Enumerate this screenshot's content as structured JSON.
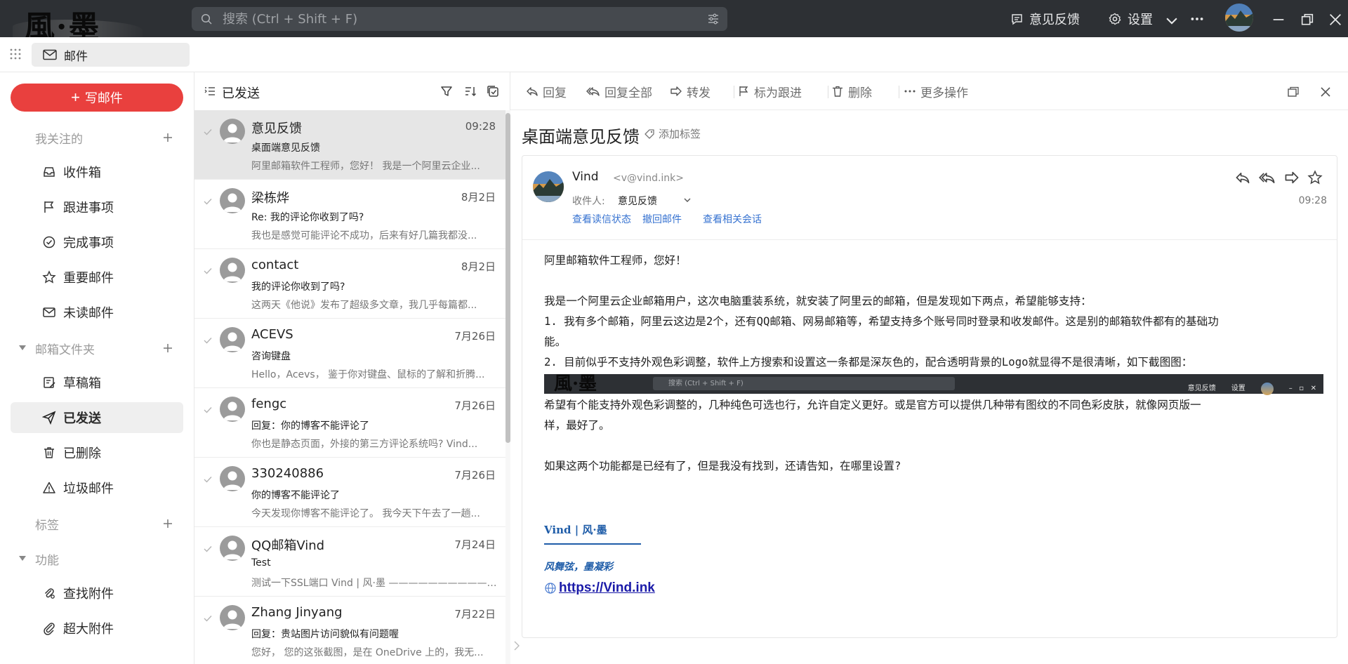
{
  "topbar": {
    "logo_text": "風·墨",
    "search_placeholder": "搜索 (Ctrl + Shift + F)",
    "feedback_label": "意见反馈",
    "settings_label": "设置",
    "icons": [
      "search-icon",
      "filter-icon",
      "feedback-icon",
      "gear-icon",
      "chevron-down-icon",
      "more-icon",
      "avatar",
      "minimize-icon",
      "restore-icon",
      "close-icon"
    ]
  },
  "tabbar": {
    "tab_label": "邮件"
  },
  "sidebar": {
    "compose_label": "写邮件",
    "sections": {
      "followed": "我关注的",
      "folders": "邮箱文件夹",
      "tags": "标签",
      "functions": "功能"
    },
    "followed_items": [
      "收件箱",
      "跟进事项",
      "完成事项",
      "重要邮件",
      "未读邮件"
    ],
    "folder_items": [
      "草稿箱",
      "已发送",
      "已删除",
      "垃圾邮件"
    ],
    "function_items": [
      "查找附件",
      "超大附件"
    ],
    "active_item": "已发送"
  },
  "list": {
    "title": "已发送",
    "items": [
      {
        "from": "意见反馈",
        "date": "09:28",
        "subject": "桌面端意见反馈",
        "preview": "阿里邮箱软件工程师，您好！ 我是一个阿里云企业...",
        "selected": true
      },
      {
        "from": "梁栋烨",
        "date": "8月2日",
        "subject": "Re: 我的评论你收到了吗?",
        "preview": "我也是感觉可能评论不成功，后来有好几篇我都没...",
        "selected": false
      },
      {
        "from": "contact",
        "date": "8月2日",
        "subject": "我的评论你收到了吗?",
        "preview": "这两天《他说》发布了超级多文章，我几乎每篇都...",
        "selected": false
      },
      {
        "from": "ACEVS",
        "date": "7月26日",
        "subject": "咨询键盘",
        "preview": "Hello，Acevs， 鉴于你对键盘、鼠标的了解和折腾...",
        "selected": false
      },
      {
        "from": "fengc",
        "date": "7月26日",
        "subject": "回复：你的博客不能评论了",
        "preview": "你也是静态页面，外接的第三方评论系统吗? Vind...",
        "selected": false
      },
      {
        "from": "330240886",
        "date": "7月26日",
        "subject": "你的博客不能评论了",
        "preview": "今天发现你博客不能评论了。 我今天下午去了一趟...",
        "selected": false
      },
      {
        "from": "QQ邮箱Vind",
        "date": "7月24日",
        "subject": "Test",
        "preview": "测试一下SSL端口 Vind | 风·墨 —————————— ...",
        "selected": false
      },
      {
        "from": "Zhang Jinyang",
        "date": "7月22日",
        "subject": "回复：贵站图片访问貌似有问题喔",
        "preview": "您好， 您的这张截图，是在 OneDrive 上的，我无...",
        "selected": false
      }
    ]
  },
  "reader": {
    "toolbar": {
      "reply": "回复",
      "reply_all": "回复全部",
      "forward": "转发",
      "flag": "标为跟进",
      "delete": "删除",
      "more": "更多操作"
    },
    "subject": "桌面端意见反馈",
    "add_tag": "添加标签",
    "sender_name": "Vind",
    "sender_addr": "<v@vind.ink>",
    "recipient_label": "收件人:",
    "recipient": "意见反馈",
    "time": "09:28",
    "links": [
      "查看读信状态",
      "撤回邮件",
      "查看相关会话"
    ],
    "body": {
      "greeting": "阿里邮箱软件工程师，您好！",
      "p1": "我是一个阿里云企业邮箱用户，这次电脑重装系统，就安装了阿里云的邮箱，但是发现如下两点，希望能够支持：",
      "item1_line1": "1. 我有多个邮箱，阿里云这边是2个，还有QQ邮箱、网易邮箱等，希望支持多个账号同时登录和收发邮件。这是别的邮箱软件都有的基础功",
      "item1_line2": "能。",
      "item2": "2. 目前似乎不支持外观色彩调整，软件上方搜索和设置这一条都是深灰色的，配合透明背景的Logo就显得不是很清晰，如下截图图：",
      "p2_line1": "希望有个能支持外观色彩调整的，几种纯色可选也行，允许自定义更好。或是官方可以提供几种带有图纹的不同色彩皮肤，就像网页版一",
      "p2_line2": "样，最好了。",
      "p3": "如果这两个功能都是已经有了，但是我没有找到，还请告知，在哪里设置?",
      "screenshot": {
        "logo": "風·墨",
        "search": "搜索 (Ctrl + Shift + F)",
        "feedback": "意见反馈",
        "settings": "设置"
      },
      "signature": {
        "name": "Vind | 风·墨",
        "motto": "风舞弦，墨凝彩",
        "url": "https://Vind.ink"
      }
    }
  }
}
